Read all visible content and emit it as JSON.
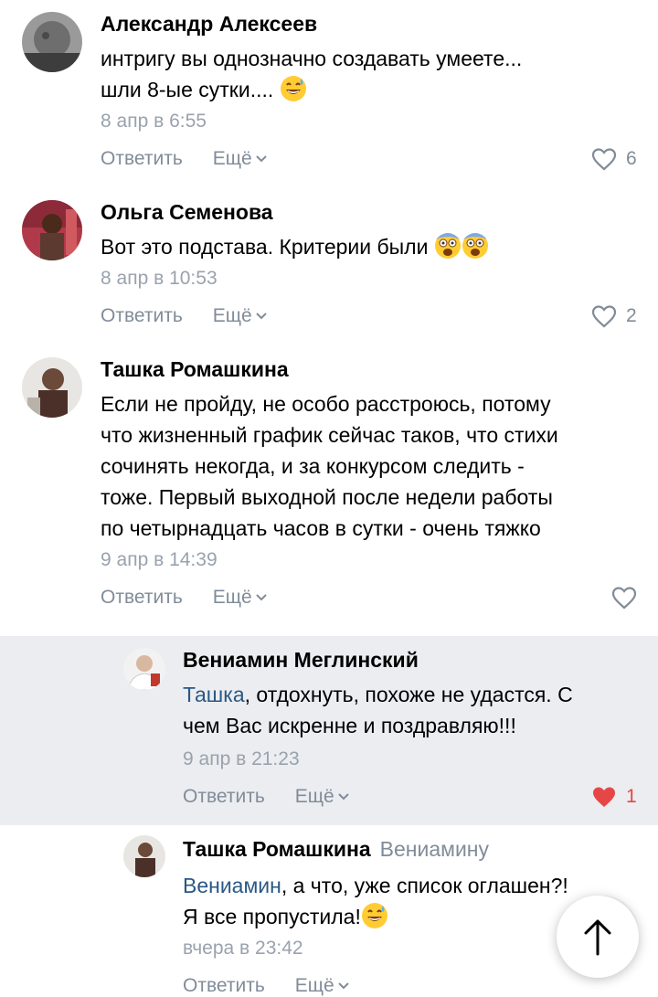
{
  "comments": [
    {
      "author": "Александр Алексеев",
      "lines": [
        "интригу вы однозначно создавать умеете...",
        "шли 8-ые сутки.... "
      ],
      "date": "8 апр в 6:55",
      "reply_label": "Ответить",
      "more_label": "Ещё",
      "likes": "6"
    },
    {
      "author": "Ольга Семенова",
      "lines": [
        "Вот это подстава. Критерии были "
      ],
      "date": "8 апр в 10:53",
      "reply_label": "Ответить",
      "more_label": "Ещё",
      "likes": "2"
    },
    {
      "author": "Ташка Ромашкина",
      "lines": [
        "Если не пройду, не особо расстроюсь, потому",
        "что жизненный график сейчас таков, что стихи",
        "сочинять некогда, и за конкурсом следить -",
        "тоже. Первый выходной после недели работы",
        "по четырнадцать часов в сутки - очень тяжко"
      ],
      "date": "9 апр в 14:39",
      "reply_label": "Ответить",
      "more_label": "Ещё"
    },
    {
      "author": "Вениамин Меглинский",
      "mention": "Ташка",
      "lines": [
        ", отдохнуть, похоже не удастся. С",
        "чем Вас искренне и поздравляю!!!"
      ],
      "date": "9 апр в 21:23",
      "reply_label": "Ответить",
      "more_label": "Ещё",
      "likes": "1"
    },
    {
      "author": "Ташка Ромашкина",
      "reply_to": "Вениамину",
      "mention": "Вениамин",
      "lines": [
        ", а что, уже список оглашен?!",
        "Я все пропустила!"
      ],
      "date": "вчера в 23:42",
      "reply_label": "Ответить",
      "more_label": "Ещё"
    }
  ],
  "colors": {
    "link": "#2a5885",
    "secondary": "#818c99",
    "date": "#99a2ad",
    "highlight_bg": "#ebedf0",
    "liked_heart": "#e64646"
  },
  "icons": {
    "like": "heart-outline-icon",
    "liked": "heart-filled-icon",
    "more": "chevron-down-icon",
    "scroll_top": "arrow-up-icon",
    "emoji_sweat": "grinning-sweat-emoji",
    "emoji_scream": "screaming-face-emoji"
  }
}
